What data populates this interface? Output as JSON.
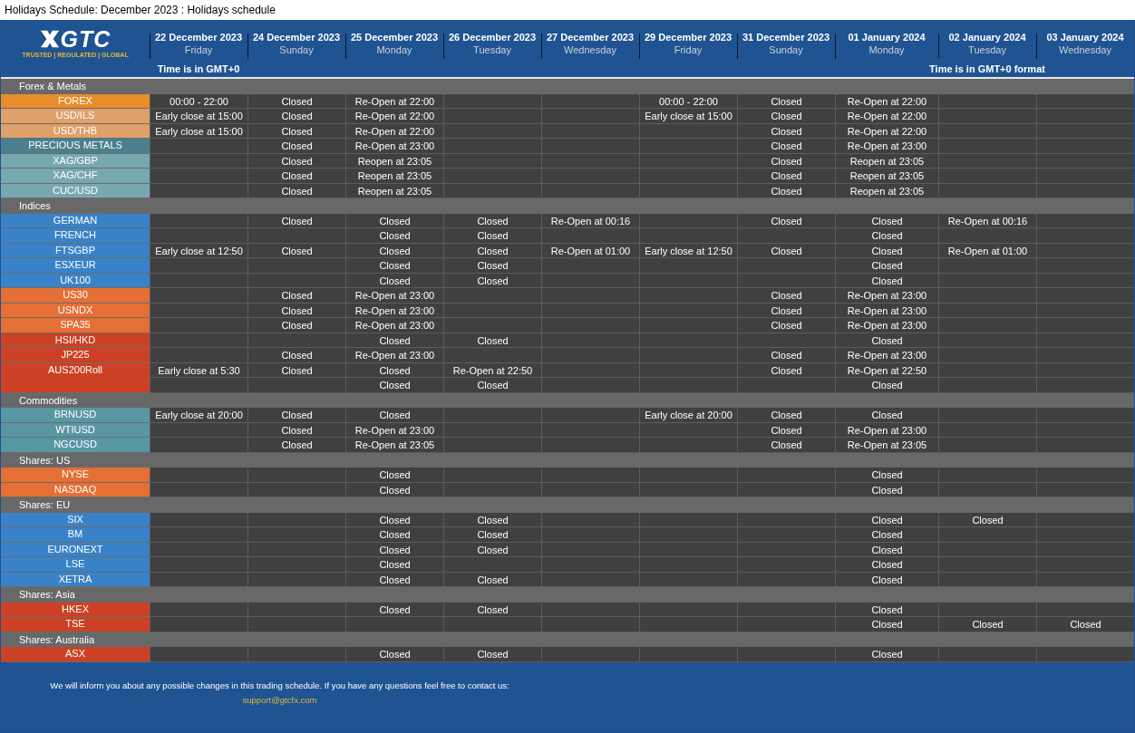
{
  "page_title": "Holidays Schedule: December 2023 : Holidays schedule",
  "logo": {
    "wordmark": "GTC",
    "tagline": "TRUSTED | REGULATED | GLOBAL"
  },
  "columns": [
    {
      "date": "22 December 2023",
      "weekday": "Friday",
      "note": "Time is in GMT+0"
    },
    {
      "date": "24 December 2023",
      "weekday": "Sunday"
    },
    {
      "date": "25 December 2023",
      "weekday": "Monday"
    },
    {
      "date": "26 December 2023",
      "weekday": "Tuesday"
    },
    {
      "date": "27 December 2023",
      "weekday": "Wednesday"
    },
    {
      "date": "29 December 2023",
      "weekday": "Friday"
    },
    {
      "date": "31 December 2023",
      "weekday": "Sunday"
    },
    {
      "date": "01 January 2024",
      "weekday": "Monday"
    },
    {
      "date": "02 January 2024",
      "weekday": "Tuesday",
      "note": "Time is in GMT+0 format"
    },
    {
      "date": "03 January 2024",
      "weekday": "Wednesday"
    }
  ],
  "sections": [
    {
      "title": "Forex & Metals",
      "rows": [
        {
          "name": "FOREX",
          "color": "#e88d2a",
          "cells": [
            "00:00 - 22:00",
            "Closed",
            "Re-Open at 22:00",
            null,
            null,
            "00:00 - 22:00",
            "Closed",
            "Re-Open at 22:00",
            null,
            null
          ]
        },
        {
          "name": "USD/ILS",
          "color": "#dfa06a",
          "cells": [
            "Early close at 15:00",
            "Closed",
            "Re-Open at 22:00",
            null,
            null,
            "Early close at 15:00",
            "Closed",
            "Re-Open at 22:00",
            null,
            null
          ]
        },
        {
          "name": "USD/THB",
          "color": "#dfa06a",
          "cells": [
            "Early close at 15:00",
            "Closed",
            "Re-Open at 22:00",
            null,
            null,
            null,
            "Closed",
            "Re-Open at 22:00",
            null,
            null
          ]
        },
        {
          "name": "PRECIOUS METALS",
          "color": "#4a808e",
          "cells": [
            null,
            "Closed",
            "Re-Open at 23:00",
            null,
            null,
            null,
            "Closed",
            "Re-Open at 23:00",
            null,
            null
          ]
        },
        {
          "name": "XAG/GBP",
          "color": "#77a8b0",
          "cells": [
            null,
            "Closed",
            "Reopen at 23:05",
            null,
            null,
            null,
            "Closed",
            "Reopen at 23:05",
            null,
            null
          ]
        },
        {
          "name": "XAG/CHF",
          "color": "#77a8b0",
          "cells": [
            null,
            "Closed",
            "Reopen at 23:05",
            null,
            null,
            null,
            "Closed",
            "Reopen at 23:05",
            null,
            null
          ]
        },
        {
          "name": "CUC/USD",
          "color": "#77a8b0",
          "cells": [
            null,
            "Closed",
            "Reopen at 23:05",
            null,
            null,
            null,
            "Closed",
            "Reopen at 23:05",
            null,
            null
          ]
        }
      ]
    },
    {
      "title": "Indices",
      "rows": [
        {
          "name": "GERMAN",
          "color": "#3a82c8",
          "cells": [
            null,
            "Closed",
            "Closed",
            "Closed",
            "Re-Open at 00:16",
            null,
            "Closed",
            "Closed",
            "Re-Open at 00:16",
            null
          ]
        },
        {
          "name": "FRENCH",
          "color": "#3a82c8",
          "cells": [
            null,
            null,
            "Closed",
            "Closed",
            null,
            null,
            null,
            "Closed",
            null,
            null
          ]
        },
        {
          "name": "FTSGBP",
          "color": "#3a82c8",
          "cells": [
            "Early close at 12:50",
            "Closed",
            "Closed",
            "Closed",
            "Re-Open at 01:00",
            "Early close at 12:50",
            "Closed",
            "Closed",
            "Re-Open at 01:00",
            null
          ]
        },
        {
          "name": "ESXEUR",
          "color": "#3a82c8",
          "cells": [
            null,
            null,
            "Closed",
            "Closed",
            null,
            null,
            null,
            "Closed",
            null,
            null
          ]
        },
        {
          "name": "UK100",
          "color": "#3a82c8",
          "cells": [
            null,
            null,
            "Closed",
            "Closed",
            null,
            null,
            null,
            "Closed",
            null,
            null
          ]
        },
        {
          "name": "US30",
          "color": "#e66f35",
          "cells": [
            null,
            "Closed",
            "Re-Open at 23:00",
            null,
            null,
            null,
            "Closed",
            "Re-Open at 23:00",
            null,
            null
          ]
        },
        {
          "name": "USNDX",
          "color": "#e66f35",
          "cells": [
            null,
            "Closed",
            "Re-Open at 23:00",
            null,
            null,
            null,
            "Closed",
            "Re-Open at 23:00",
            null,
            null
          ]
        },
        {
          "name": "SPA35",
          "color": "#e66f35",
          "cells": [
            null,
            "Closed",
            "Re-Open at 23:00",
            null,
            null,
            null,
            "Closed",
            "Re-Open at 23:00",
            null,
            null
          ]
        },
        {
          "name": "HSI/HKD",
          "color": "#cc4125",
          "cells": [
            null,
            null,
            "Closed",
            "Closed",
            null,
            null,
            null,
            "Closed",
            null,
            null
          ]
        },
        {
          "name": "JP225",
          "color": "#cc4125",
          "cells": [
            null,
            "Closed",
            "Re-Open at 23:00",
            null,
            null,
            null,
            "Closed",
            "Re-Open at 23:00",
            null,
            null
          ]
        },
        {
          "name": "AUS200Roll",
          "color": "#cc4125",
          "cells": [
            "Early close at 5:30",
            "Closed",
            "Closed",
            "Re-Open at 22:50",
            null,
            null,
            "Closed",
            "Re-Open at 22:50",
            null,
            null
          ],
          "extra_cells": [
            null,
            null,
            "Closed",
            "Closed",
            null,
            null,
            null,
            "Closed",
            null,
            null
          ]
        }
      ]
    },
    {
      "title": "Commodities",
      "rows": [
        {
          "name": "BRNUSD",
          "color": "#5897a3",
          "cells": [
            "Early close at 20:00",
            "Closed",
            "Closed",
            null,
            null,
            "Early close at 20:00",
            "Closed",
            "Closed",
            null,
            null
          ]
        },
        {
          "name": "WTIUSD",
          "color": "#5897a3",
          "cells": [
            null,
            "Closed",
            "Re-Open at 23:00",
            null,
            null,
            null,
            "Closed",
            "Re-Open at 23:00",
            null,
            null
          ]
        },
        {
          "name": "NGCUSD",
          "color": "#5897a3",
          "cells": [
            null,
            "Closed",
            "Re-Open at 23:05",
            null,
            null,
            null,
            "Closed",
            "Re-Open at 23:05",
            null,
            null
          ]
        }
      ]
    },
    {
      "title": "Shares: US",
      "rows": [
        {
          "name": "NYSE",
          "color": "#e66f35",
          "cells": [
            null,
            null,
            "Closed",
            null,
            null,
            null,
            null,
            "Closed",
            null,
            null
          ]
        },
        {
          "name": "NASDAQ",
          "color": "#e66f35",
          "cells": [
            null,
            null,
            "Closed",
            null,
            null,
            null,
            null,
            "Closed",
            null,
            null
          ]
        }
      ]
    },
    {
      "title": "Shares: EU",
      "rows": [
        {
          "name": "SIX",
          "color": "#3a82c8",
          "cells": [
            null,
            null,
            "Closed",
            "Closed",
            null,
            null,
            null,
            "Closed",
            "Closed",
            null
          ]
        },
        {
          "name": "BM",
          "color": "#3a82c8",
          "cells": [
            null,
            null,
            "Closed",
            "Closed",
            null,
            null,
            null,
            "Closed",
            null,
            null
          ]
        },
        {
          "name": "EURONEXT",
          "color": "#3a82c8",
          "cells": [
            null,
            null,
            "Closed",
            "Closed",
            null,
            null,
            null,
            "Closed",
            null,
            null
          ]
        },
        {
          "name": "LSE",
          "color": "#3a82c8",
          "cells": [
            null,
            null,
            "Closed",
            null,
            null,
            null,
            null,
            "Closed",
            null,
            null
          ]
        },
        {
          "name": "XETRA",
          "color": "#3a82c8",
          "cells": [
            null,
            null,
            "Closed",
            "Closed",
            null,
            null,
            null,
            "Closed",
            null,
            null
          ]
        }
      ]
    },
    {
      "title": "Shares: Asia",
      "rows": [
        {
          "name": "HKEX",
          "color": "#cc4125",
          "cells": [
            null,
            null,
            "Closed",
            "Closed",
            null,
            null,
            null,
            "Closed",
            null,
            null
          ]
        },
        {
          "name": "TSE",
          "color": "#cc4125",
          "cells": [
            null,
            null,
            null,
            null,
            null,
            null,
            null,
            "Closed",
            "Closed",
            "Closed"
          ]
        }
      ]
    },
    {
      "title": "Shares: Australia",
      "rows": [
        {
          "name": "ASX",
          "color": "#cc4125",
          "cells": [
            null,
            null,
            "Closed",
            "Closed",
            null,
            null,
            null,
            "Closed",
            null,
            null
          ]
        }
      ]
    }
  ],
  "footer": {
    "message": "We will inform you about any possible changes in this trading schedule. If you have any questions feel free to contact us:",
    "email": "support@gtcfx.com"
  }
}
